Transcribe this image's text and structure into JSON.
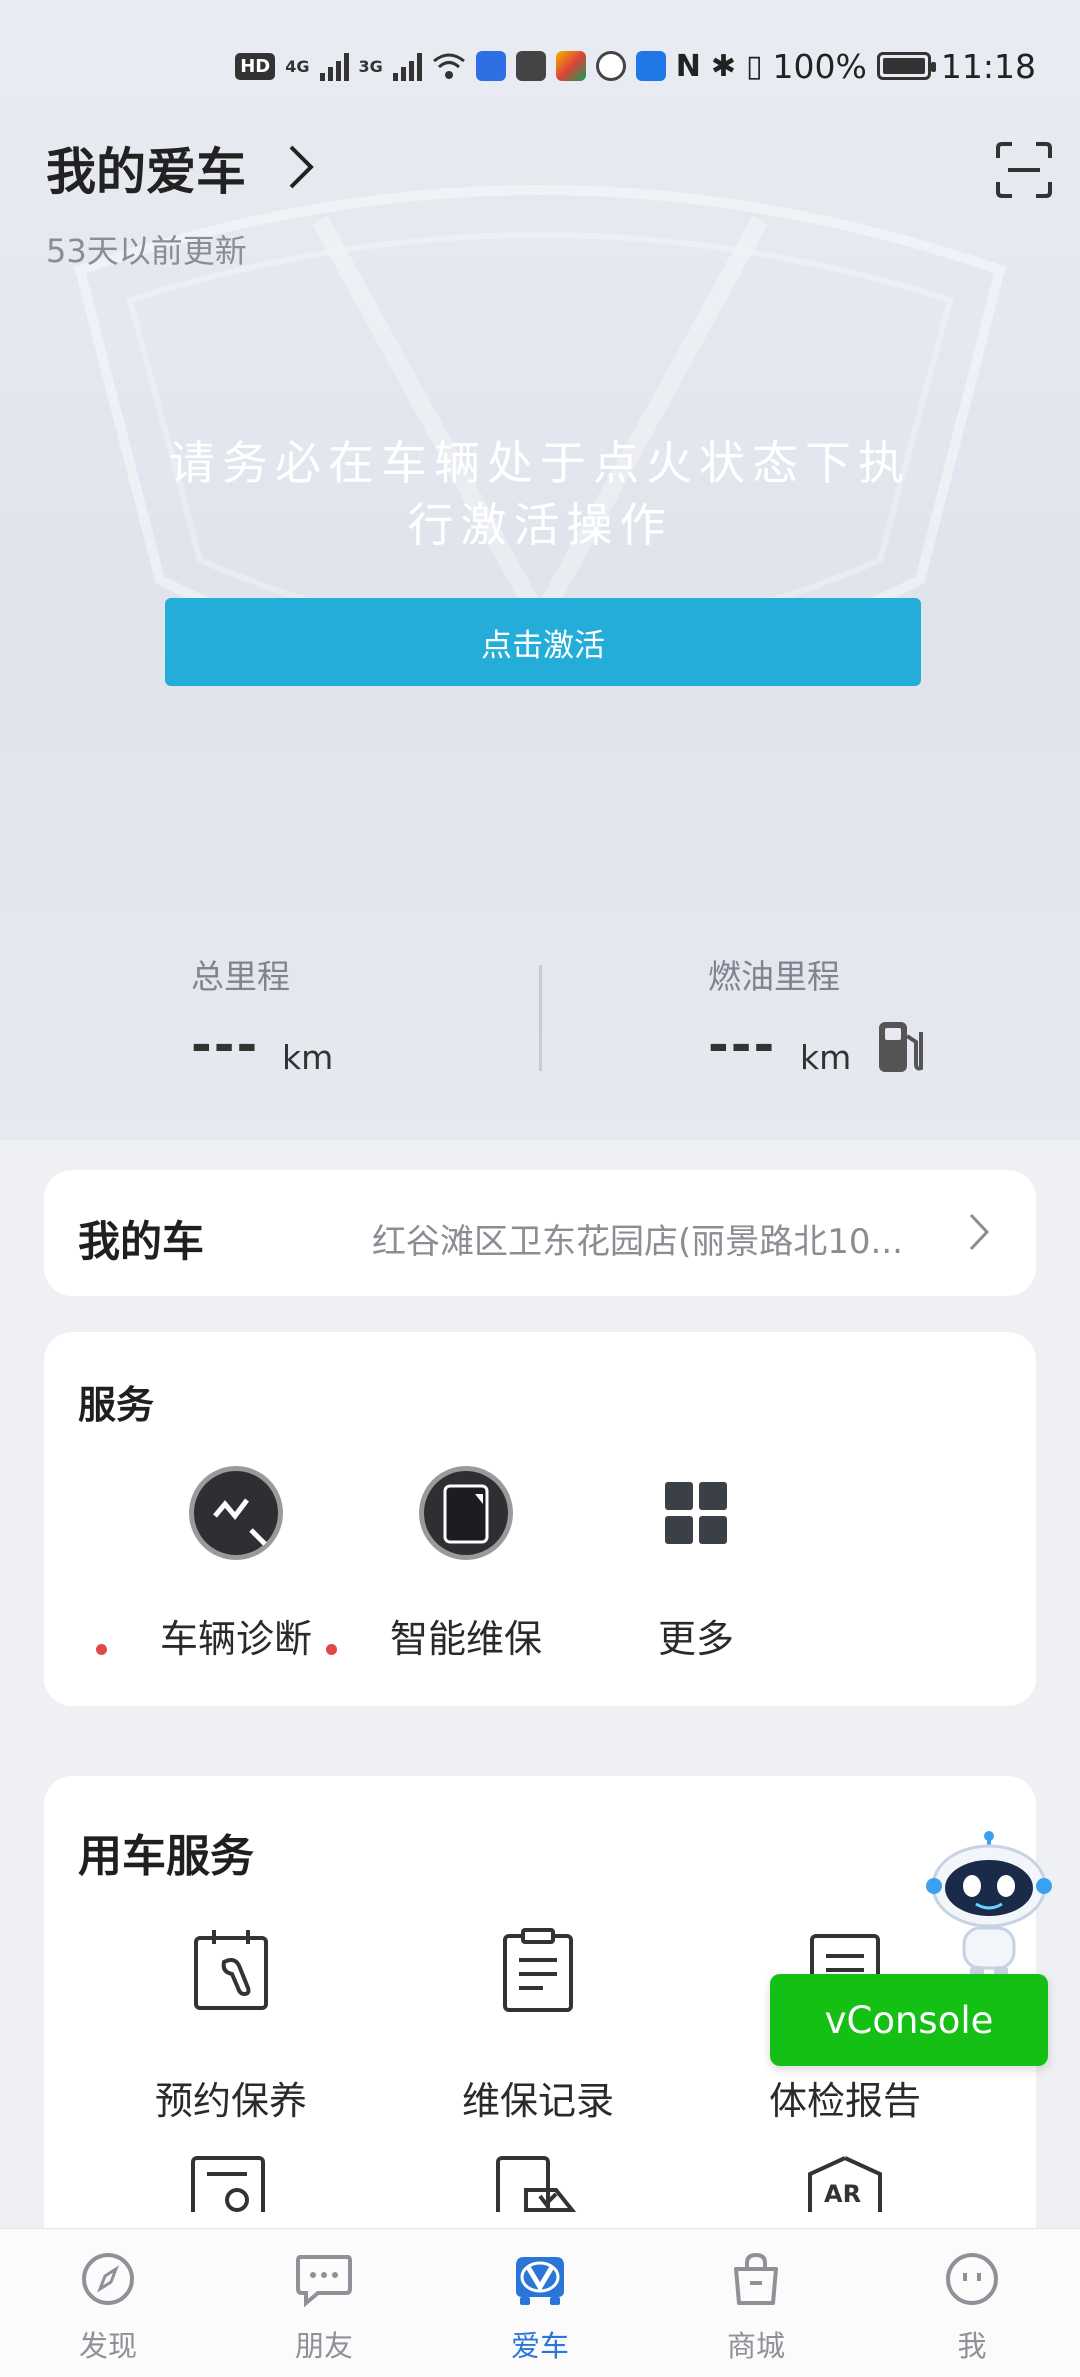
{
  "status_bar": {
    "hd": "HD",
    "net1": "4G",
    "net2": "3G",
    "battery": "100%",
    "time": "11:18"
  },
  "header": {
    "title": "我的爱车",
    "updated": "53天以前更新"
  },
  "activation": {
    "notice_line1": "请务必在车辆处于点火状态下执",
    "notice_line2": "行激活操作",
    "button": "点击激活"
  },
  "stats": {
    "total": {
      "label": "总里程",
      "value": "---",
      "unit": "km"
    },
    "fuel": {
      "label": "燃油里程",
      "value": "---",
      "unit": "km"
    }
  },
  "my_car": {
    "title": "我的车",
    "store": "红谷滩区卫东花园店(丽景路北10..."
  },
  "services": {
    "title": "服务",
    "items": [
      {
        "label": "车辆诊断",
        "icon": "diagnosis-icon"
      },
      {
        "label": "智能维保",
        "icon": "maintenance-icon"
      },
      {
        "label": "更多",
        "icon": "grid-icon"
      }
    ]
  },
  "used_car": {
    "title": "用车服务",
    "items": [
      {
        "label": "预约保养",
        "icon": "wrench-calendar-icon"
      },
      {
        "label": "维保记录",
        "icon": "clipboard-icon"
      },
      {
        "label": "体检报告",
        "icon": "report-icon"
      }
    ]
  },
  "vconsole": {
    "label": "vConsole"
  },
  "tabbar": {
    "items": [
      {
        "label": "发现",
        "icon": "compass-icon"
      },
      {
        "label": "朋友",
        "icon": "chat-icon"
      },
      {
        "label": "爱车",
        "icon": "car-icon"
      },
      {
        "label": "商城",
        "icon": "bag-icon"
      },
      {
        "label": "我",
        "icon": "face-icon"
      }
    ],
    "active_color": "#2a76d8",
    "inactive_color": "#8e9298"
  },
  "colors": {
    "activate_button": "#23add8",
    "vconsole": "#15c015",
    "badge_dot": "#e24848"
  }
}
